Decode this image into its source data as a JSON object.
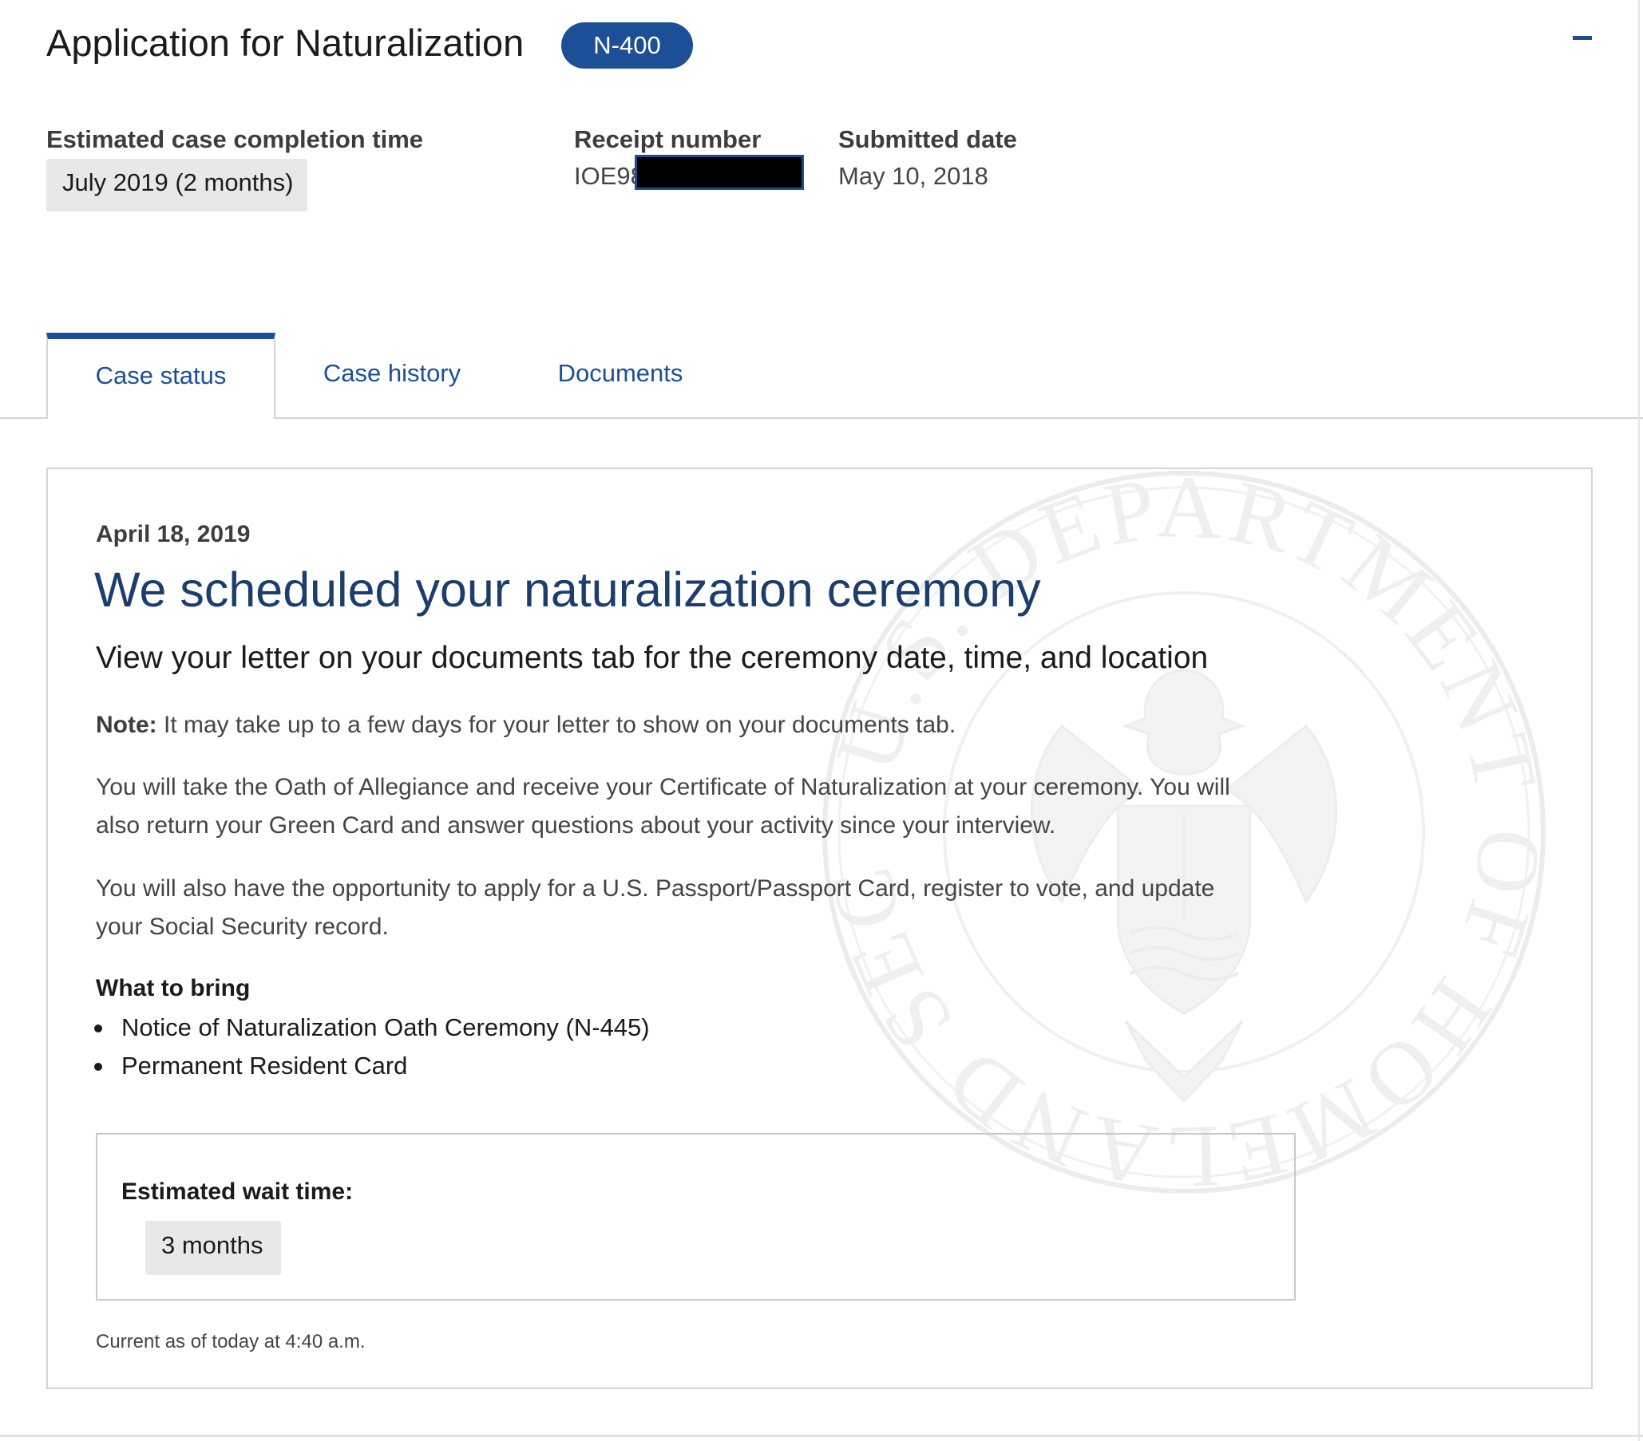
{
  "header": {
    "title": "Application for Naturalization",
    "form_badge": "N-400",
    "collapse_symbol": "minus-icon"
  },
  "meta": {
    "completion_label": "Estimated case completion time",
    "completion_value": "July 2019 (2 months)",
    "receipt_label": "Receipt number",
    "receipt_value": "IOE98",
    "submitted_label": "Submitted date",
    "submitted_value": "May 10, 2018"
  },
  "tabs": [
    {
      "label": "Case status",
      "active": true
    },
    {
      "label": "Case history",
      "active": false
    },
    {
      "label": "Documents",
      "active": false
    }
  ],
  "status": {
    "date": "April 18, 2019",
    "title": "We scheduled your naturalization ceremony",
    "subtitle": "View your letter on your documents tab for the ceremony date, time, and location",
    "note_label": "Note:",
    "note_text": " It may take up to a few days for your letter to show on your documents tab.",
    "para1_line1": "You will take the Oath of Allegiance and receive your Certificate of Naturalization at your ceremony. You will",
    "para1_line2": "also return your Green Card and answer questions about your activity since your interview.",
    "para2_line1": "You will also have the opportunity to apply for a U.S. Passport/Passport Card, register to vote, and update",
    "para2_line2": "your Social Security record.",
    "bring_heading": "What to bring",
    "bring_items": [
      "Notice of Naturalization Oath Ceremony (N-445)",
      "Permanent Resident Card"
    ],
    "wait_label": "Estimated wait time:",
    "wait_value": "3 months",
    "current_as_of": "Current as of today at 4:40 a.m."
  },
  "seal_text": "U.S. DEPARTMENT OF HOMELAND SECURITY",
  "colors": {
    "brand_blue": "#1c4f96",
    "title_navy": "#1c3d6e",
    "pill_gray": "#e8e8e8",
    "border_gray": "#d4d4d4"
  }
}
